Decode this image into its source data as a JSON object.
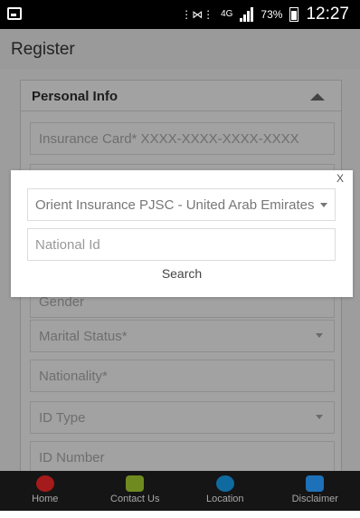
{
  "status_bar": {
    "network": "4G",
    "battery": "73%",
    "time": "12:27"
  },
  "app": {
    "title": "Register"
  },
  "panel": {
    "title": "Personal Info"
  },
  "form_fields": [
    {
      "label": "Insurance Card* XXXX-XXXX-XXXX-XXXX",
      "type": "text"
    },
    {
      "label": "Gender",
      "type": "text"
    },
    {
      "label": "Marital Status*",
      "type": "select"
    },
    {
      "label": "Nationality*",
      "type": "text"
    },
    {
      "label": "ID Type",
      "type": "select"
    },
    {
      "label": "ID Number",
      "type": "text"
    }
  ],
  "modal": {
    "close_label": "X",
    "insurer_selected": "Orient Insurance PJSC - United Arab Emirates",
    "national_id_placeholder": "National Id",
    "search_label": "Search"
  },
  "bottom_nav": [
    {
      "label": "Home",
      "icon": "home-icon",
      "color": "#a51a1a"
    },
    {
      "label": "Contact Us",
      "icon": "contact-icon",
      "color": "#6f8a1f"
    },
    {
      "label": "Location",
      "icon": "location-icon",
      "color": "#0f6aa0"
    },
    {
      "label": "Disclaimer",
      "icon": "disclaimer-icon",
      "color": "#1d71b8"
    }
  ]
}
